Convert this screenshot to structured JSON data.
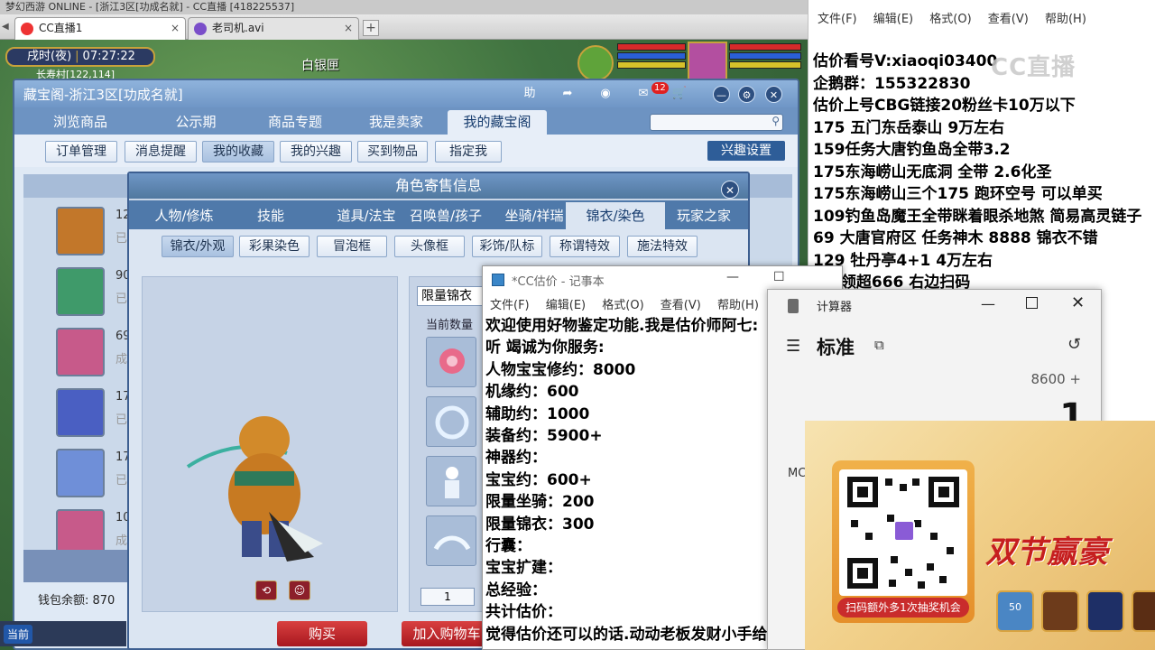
{
  "browser": {
    "top_strip": "梦幻西游 ONLINE  -  [浙江3区[功成名就]  -  CC直播 [418225537]",
    "tabs": [
      {
        "label": "CC直播1"
      },
      {
        "label": "老司机.avi"
      }
    ],
    "close_glyph": "×",
    "new_tab_glyph": "+"
  },
  "hud": {
    "time_of_day": "戌时(夜)",
    "clock": "07:27:22",
    "location": "长寿村[122,114]",
    "map_label": "白银匣"
  },
  "cbg": {
    "title": "藏宝阁-浙江3区[功成名就]",
    "nav_tabs": [
      "浏览商品",
      "公示期",
      "商品专题",
      "我是卖家",
      "我的藏宝阁"
    ],
    "sub_buttons": [
      "订单管理",
      "消息提醒",
      "我的收藏",
      "我的兴趣",
      "买到物品",
      "指定我"
    ],
    "interest_settings": "兴趣设置",
    "msg_badge": "12",
    "help_label": "助",
    "list_rows": [
      {
        "num": "12",
        "sub": "已"
      },
      {
        "num": "90",
        "sub": "已"
      },
      {
        "num": "69",
        "sub": "成"
      },
      {
        "num": "17",
        "sub": "已"
      },
      {
        "num": "17",
        "sub": "已"
      },
      {
        "num": "10",
        "sub": "成"
      }
    ],
    "wallet": "钱包余额: 870",
    "chat_current": "当前"
  },
  "role": {
    "title": "角色寄售信息",
    "close_glyph": "✕",
    "tabs": [
      "人物/修炼",
      "技能",
      "道具/法宝",
      "召唤兽/孩子",
      "坐骑/祥瑞",
      "锦衣/染色",
      "玩家之家"
    ],
    "sub_tabs": [
      "锦衣/外观",
      "彩果染色",
      "冒泡框",
      "头像框",
      "彩饰/队标",
      "称谓特效",
      "施法特效"
    ],
    "limited_label": "限量锦衣",
    "current_qty": "当前数量",
    "page_value": "1",
    "page_sep": "/",
    "buy": "购买",
    "add_cart": "加入购物车"
  },
  "notepad_right": {
    "menu": [
      "文件(F)",
      "编辑(E)",
      "格式(O)",
      "查看(V)",
      "帮助(H)"
    ],
    "lines": [
      "估价看号V:xiaoqi03400",
      "企鹅群：155322830",
      "估价上号CBG链接20粉丝卡10万以下",
      "175 五门东岳泰山  9万左右",
      "159任务大唐钓鱼岛全带3.2",
      "175东海崂山无底洞  全带   2.6化圣",
      "175东海崂山三个175 跑环空号 可以单买",
      "109钓鱼岛魔王全带眯着眼杀地煞 简易高灵链子",
      "69  大唐官府区 任务神木 8888 锦衣不错",
      "129 牡丹亭4+1 4万左右",
      "     5V 领超666 右边扫码"
    ],
    "watermark": "CC直播"
  },
  "notepad_cc": {
    "title": "*CC估价 - 记事本",
    "min_glyph": "—",
    "max_glyph": "☐",
    "menu": [
      "文件(F)",
      "编辑(E)",
      "格式(O)",
      "查看(V)",
      "帮助(H)"
    ],
    "lines": [
      "欢迎使用好物鉴定功能.我是估价师阿七:",
      "听 竭诚为你服务:",
      "人物宝宝修约：8000",
      "机缘约：600",
      "辅助约：1000",
      "装备约：5900+",
      "神器约：",
      "宝宝约：600+",
      "限量坐骑：200",
      "限量锦衣：300",
      "行囊：",
      "宝宝扩建：",
      "总经验：",
      "共计估价：",
      "觉得估价还可以的话.动动老板发财小手给"
    ]
  },
  "calculator": {
    "title": "计算器",
    "mode": "标准",
    "keep_on_top_glyph": "⧉",
    "history_glyph": "↺",
    "menu_glyph": "☰",
    "min_glyph": "—",
    "close_glyph": "✕",
    "expression": "8600 +",
    "display": "1",
    "mc_label": "MC"
  },
  "ad": {
    "scan_tip": "扫码额外多1次抽奖机会",
    "slogan": "双节赢豪",
    "item_count": "50"
  }
}
